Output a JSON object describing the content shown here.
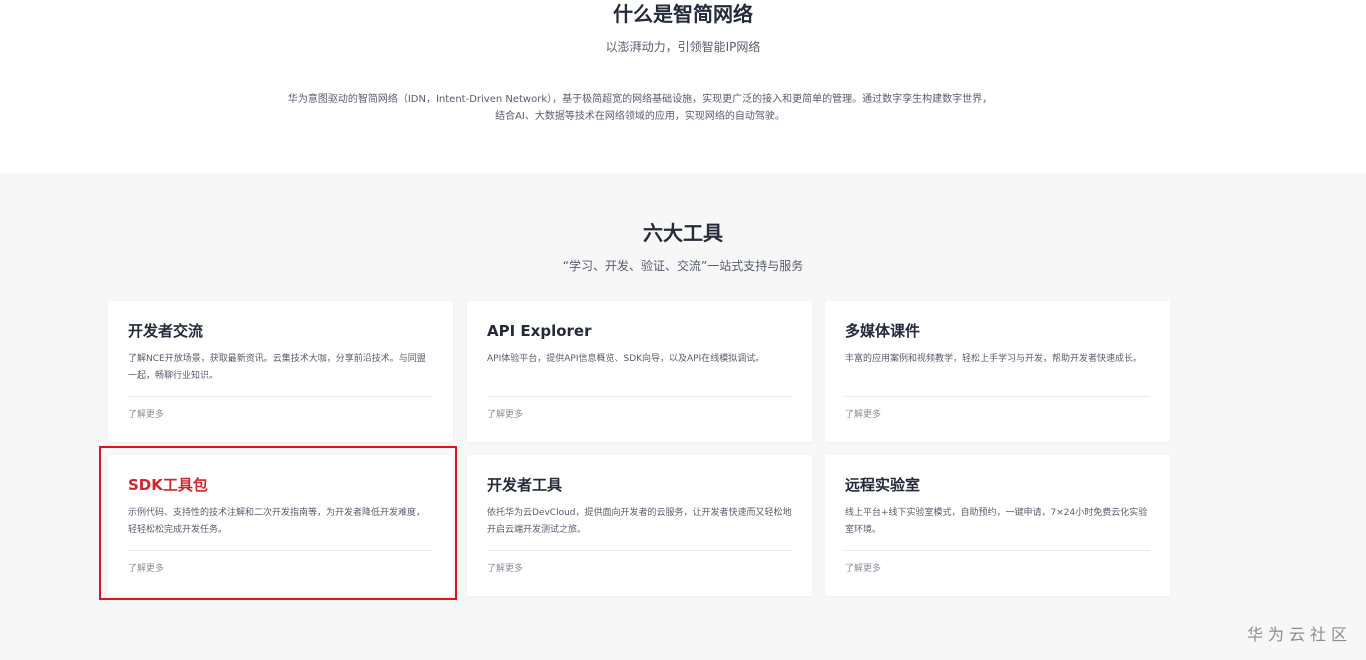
{
  "intro": {
    "title": "什么是智简网络",
    "subtitle": "以澎湃动力，引领智能IP网络",
    "description": "华为意图驱动的智简网络（IDN，Intent-Driven Network），基于极简超宽的网络基础设施，实现更广泛的接入和更简单的管理。通过数字孪生构建数字世界，结合AI、大数据等技术在网络领域的应用，实现网络的自动驾驶。"
  },
  "tools": {
    "title": "六大工具",
    "subtitle": "“学习、开发、验证、交流”一站式支持与服务",
    "cards": [
      {
        "title": "开发者交流",
        "description": "了解NCE开放场景，获取最新资讯。云集技术大咖，分享前沿技术。与同盟一起，畅聊行业知识。",
        "link": "了解更多"
      },
      {
        "title": "API Explorer",
        "description": "API体验平台，提供API信息概览、SDK向导，以及API在线模拟调试。",
        "link": "了解更多"
      },
      {
        "title": "多媒体课件",
        "description": "丰富的应用案例和视频教学，轻松上手学习与开发，帮助开发者快速成长。",
        "link": "了解更多"
      },
      {
        "title": "SDK工具包",
        "description": "示例代码、支持性的技术注解和二次开发指南等，为开发者降低开发难度，轻轻松松完成开发任务。",
        "link": "了解更多"
      },
      {
        "title": "开发者工具",
        "description": "依托华为云DevCloud，提供面向开发者的云服务，让开发者快速而又轻松地开启云端开发测试之旅。",
        "link": "了解更多"
      },
      {
        "title": "远程实验室",
        "description": "线上平台+线下实验室模式，自助预约，一键申请，7×24小时免费云化实验室环境。",
        "link": "了解更多"
      }
    ]
  },
  "watermark": "华为云社区",
  "colors": {
    "highlight_border": "#e0131a",
    "highlight_title": "#c7000b",
    "section_bg": "#f7f7f7"
  }
}
